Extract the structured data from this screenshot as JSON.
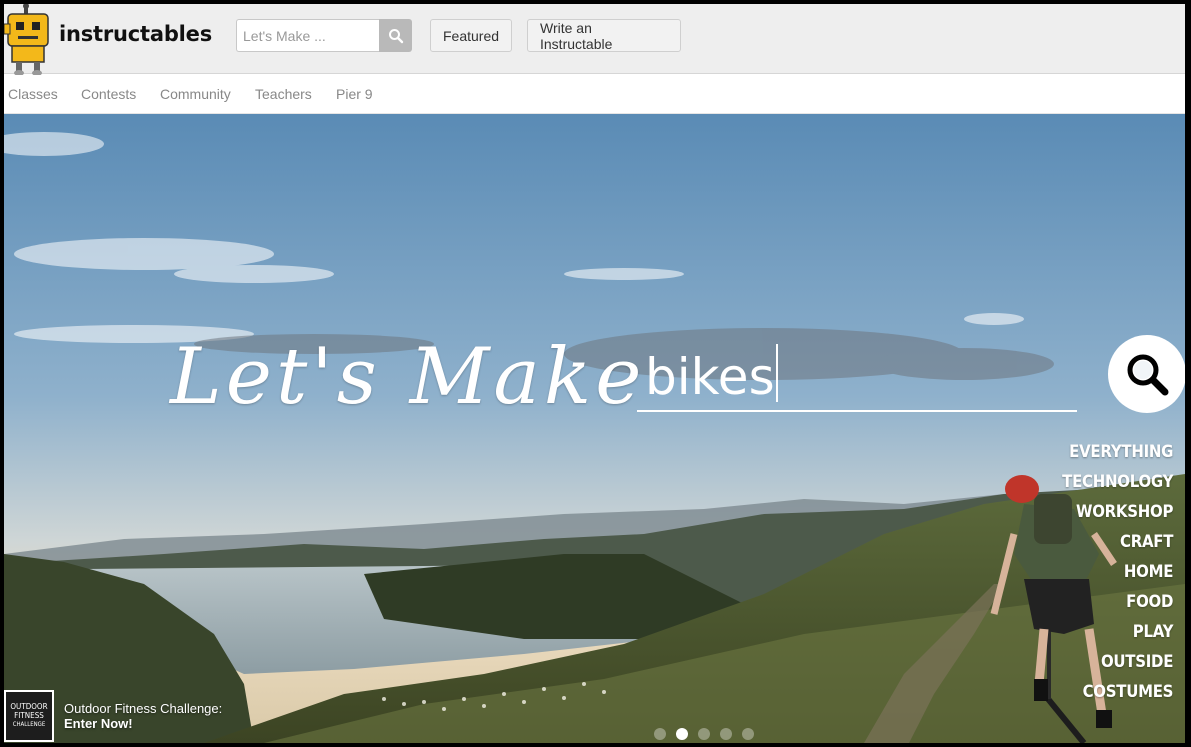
{
  "header": {
    "brand": "instructables",
    "search_placeholder": "Let's Make ...",
    "featured_label": "Featured",
    "write_label": "Write an Instructable"
  },
  "subnav": [
    "Classes",
    "Contests",
    "Community",
    "Teachers",
    "Pier 9"
  ],
  "hero": {
    "headline": "Let's Make",
    "search_value": "bikes",
    "categories": [
      "EVERYTHING",
      "TECHNOLOGY",
      "WORKSHOP",
      "CRAFT",
      "HOME",
      "FOOD",
      "PLAY",
      "OUTSIDE",
      "COSTUMES"
    ],
    "slide_count": 5,
    "active_slide": 2
  },
  "contest": {
    "thumb_lines": [
      "OUTDOOR",
      "FITNESS",
      "CHALLENGE"
    ],
    "title": "Outdoor Fitness Challenge:",
    "cta": "Enter Now!"
  },
  "colors": {
    "accent_robot": "#f3b81a",
    "header_bg": "#eeeeee",
    "sky_top": "#5f8fb8",
    "sky_horizon": "#e8d8c0"
  },
  "icons": [
    "robot-logo-icon",
    "search-icon",
    "hero-search-icon"
  ]
}
